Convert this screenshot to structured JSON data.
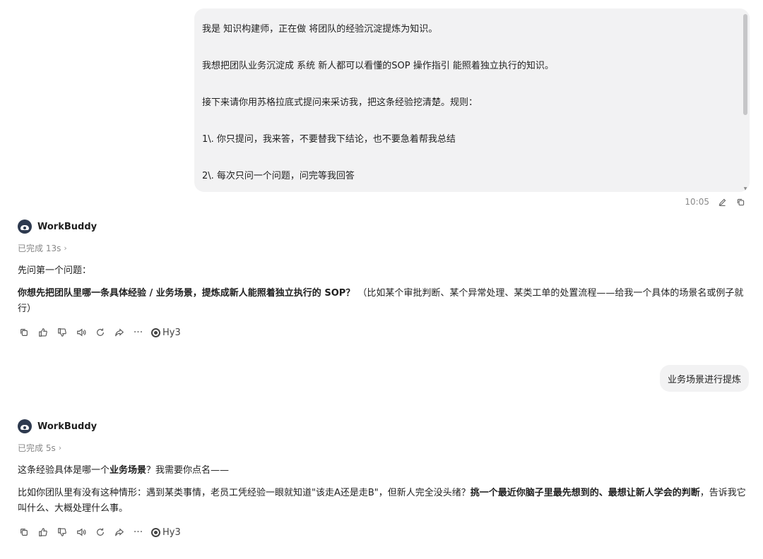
{
  "user_message_1": {
    "lines": [
      "我是 知识构建师，正在做 将团队的经验沉淀提炼为知识。",
      "我想把团队业务沉淀成 系统 新人都可以看懂的SOP 操作指引 能照着独立执行的知识。",
      "接下来请你用苏格拉底式提问来采访我，把这条经验挖清楚。规则：",
      "1\\. 你只提问，我来答，不要替我下结论，也不要急着帮我总结",
      "2\\. 每次只问一个问题，问完等我回答"
    ],
    "time": "10:05"
  },
  "assistant_1": {
    "name": "WorkBuddy",
    "status": "已完成 13s",
    "p1": "先问第一个问题：",
    "p2_bold": "你想先把团队里哪一条具体经验 / 业务场景，提炼成新人能照着独立执行的 SOP？",
    "p2_rest": "（比如某个审批判断、某个异常处理、某类工单的处置流程——给我一个具体的场景名或例子就行）",
    "model": "Hy3"
  },
  "user_message_2": {
    "text": "业务场景进行提炼"
  },
  "assistant_2": {
    "name": "WorkBuddy",
    "status": "已完成 5s",
    "p1_pre": "这条经验具体是哪一个",
    "p1_bold": "业务场景",
    "p1_post": "？我需要你点名——",
    "p2_pre": "比如你团队里有没有这种情形：遇到某类事情，老员工凭经验一眼就知道\"该走A还是走B\"，但新人完全没头绪？",
    "p2_bold": "挑一个最近你脑子里最先想到的、最想让新人学会的判断",
    "p2_post": "，告诉我它叫什么、大概处理什么事。",
    "model": "Hy3"
  },
  "icons": [
    "copy-icon",
    "thumbs-up-icon",
    "thumbs-down-icon",
    "speaker-icon",
    "refresh-icon",
    "share-icon",
    "more-icon"
  ]
}
